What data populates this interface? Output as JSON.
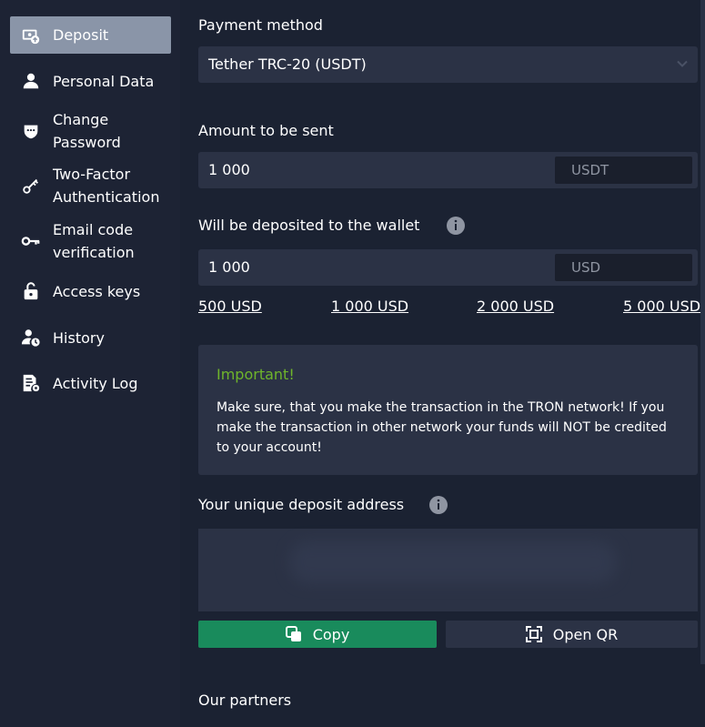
{
  "sidebar": {
    "items": [
      {
        "label": "Deposit",
        "icon": "deposit-icon",
        "active": true
      },
      {
        "label": "Personal Data",
        "icon": "user-icon"
      },
      {
        "label": "Change\nPassword",
        "icon": "shield-icon"
      },
      {
        "label": "Two-Factor\nAuthentication",
        "icon": "key-icon"
      },
      {
        "label": "Email code\nverification",
        "icon": "key-icon"
      },
      {
        "label": "Access keys",
        "icon": "unlock-icon"
      },
      {
        "label": "History",
        "icon": "user-clock-icon"
      },
      {
        "label": "Activity Log",
        "icon": "log-icon"
      }
    ]
  },
  "main": {
    "payment_method_label": "Payment method",
    "payment_method_value": "Tether TRC-20 (USDT)",
    "amount_label": "Amount to be sent",
    "amount_value": "1 000",
    "amount_currency": "USDT",
    "deposited_label": "Will be deposited to the wallet",
    "deposited_value": "1 000",
    "deposited_currency": "USD",
    "quick_amounts": [
      "500 USD",
      "1 000 USD",
      "2 000 USD",
      "5 000 USD"
    ],
    "notice_title": "Important!",
    "notice_text": "Make sure, that you make the transaction in the TRON network! If you make the transaction in other network your funds will NOT be credited to your account!",
    "address_label": "Your unique deposit address",
    "copy_label": "Copy",
    "open_qr_label": "Open QR",
    "partners_label": "Our partners"
  },
  "colors": {
    "background": "#1b2232",
    "panel": "#2b3245",
    "active_nav": "#8a95a8",
    "copy_button": "#198b5c",
    "important": "#6fb52b"
  }
}
